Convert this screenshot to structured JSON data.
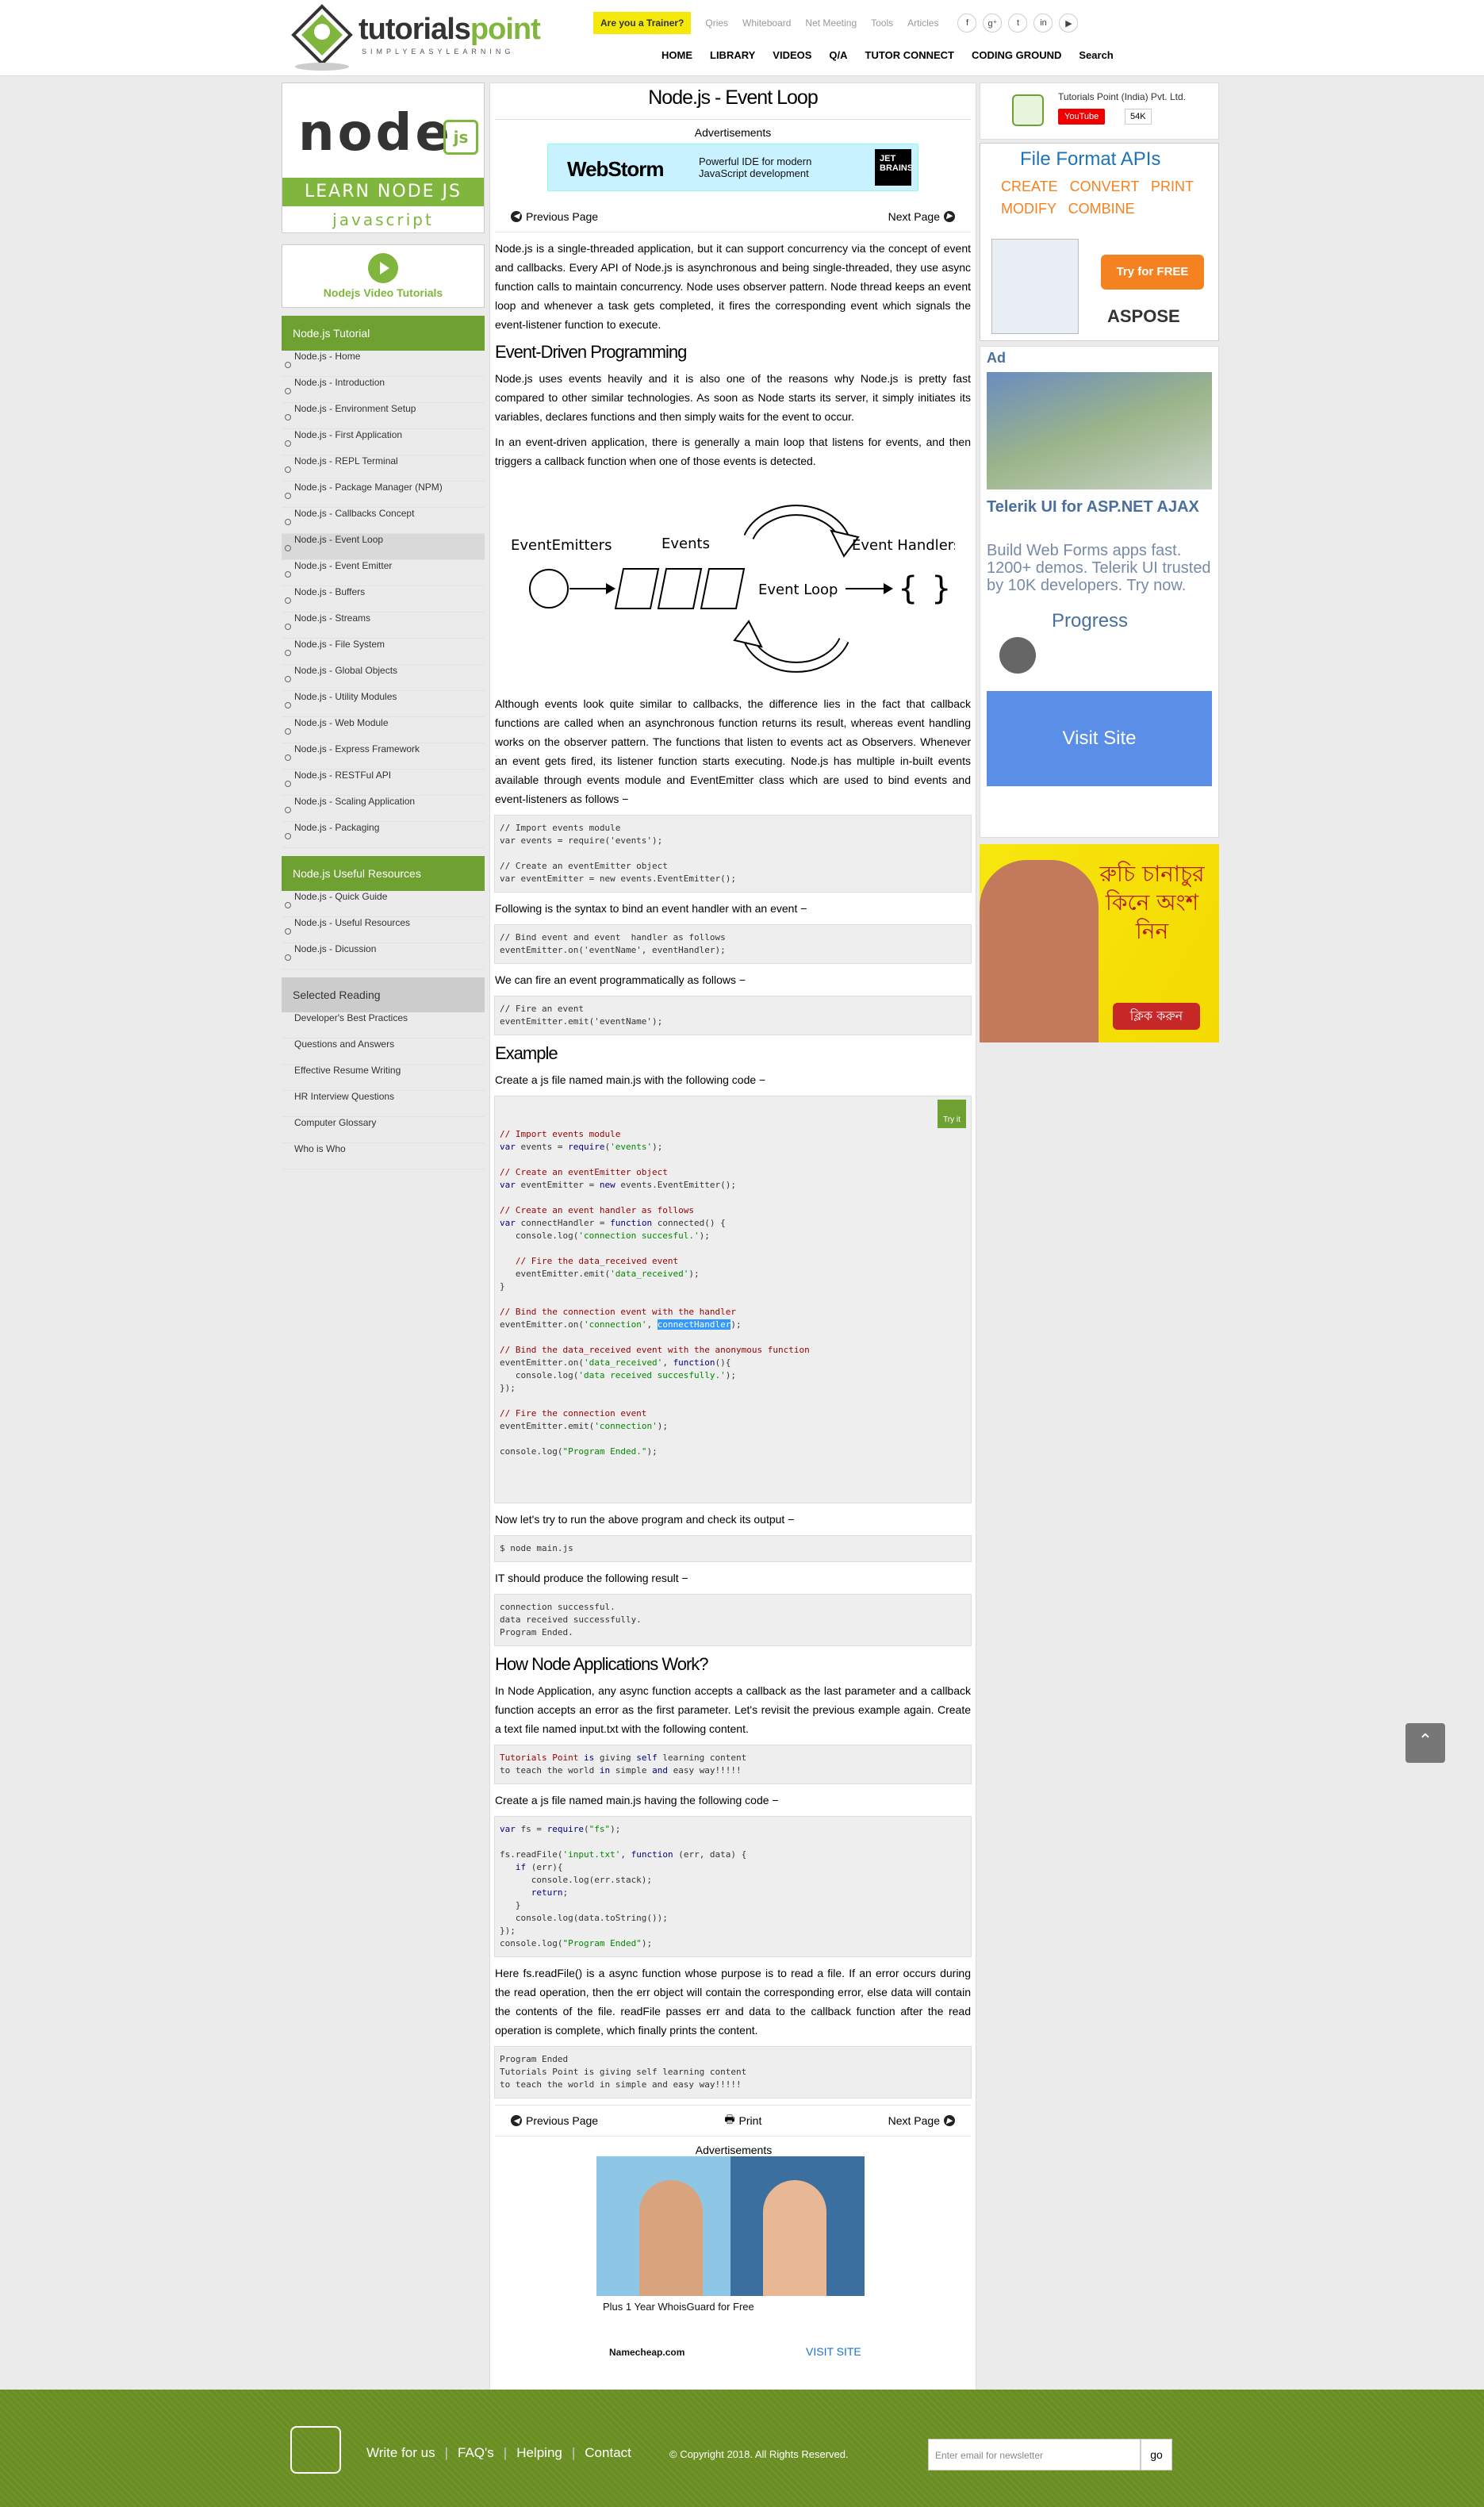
{
  "header": {
    "logo_text_a": "tutorials",
    "logo_text_b": "point",
    "logo_tagline": "SIMPLYEASYLEARNING",
    "trainer_button": "Are you a Trainer?",
    "toplinks": [
      "Qries",
      "Whiteboard",
      "Net Meeting",
      "Tools",
      "Articles"
    ],
    "social": [
      "f",
      "g⁺",
      "t",
      "in",
      "▶"
    ],
    "nav": [
      "HOME",
      "LIBRARY",
      "VIDEOS",
      "Q/A",
      "TUTOR CONNECT",
      "CODING GROUND",
      "Search"
    ]
  },
  "sidebar": {
    "node_logo": "node",
    "node_js": "js",
    "learn": "LEARN NODE JS",
    "javascript": "javascript",
    "video": "Nodejs Video Tutorials",
    "tutorial_heading": "Node.js Tutorial",
    "tutorial_items": [
      "Node.js - Home",
      "Node.js - Introduction",
      "Node.js - Environment Setup",
      "Node.js - First Application",
      "Node.js - REPL Terminal",
      "Node.js - Package Manager (NPM)",
      "Node.js - Callbacks Concept",
      "Node.js - Event Loop",
      "Node.js - Event Emitter",
      "Node.js - Buffers",
      "Node.js - Streams",
      "Node.js - File System",
      "Node.js - Global Objects",
      "Node.js - Utility Modules",
      "Node.js - Web Module",
      "Node.js - Express Framework",
      "Node.js - RESTFul API",
      "Node.js - Scaling Application",
      "Node.js - Packaging"
    ],
    "active_index": 7,
    "resources_heading": "Node.js Useful Resources",
    "resources_items": [
      "Node.js - Quick Guide",
      "Node.js - Useful Resources",
      "Node.js - Dicussion"
    ],
    "reading_heading": "Selected Reading",
    "reading_items": [
      "Developer's Best Practices",
      "Questions and Answers",
      "Effective Resume Writing",
      "HR Interview Questions",
      "Computer Glossary",
      "Who is Who"
    ]
  },
  "main": {
    "title": "Node.js - Event Loop",
    "ads_label": "Advertisements",
    "banner_brand": "WebStorm",
    "banner_text": "Powerful IDE for modern JavaScript development",
    "banner_badge": "JET BRAINS",
    "prev": "Previous Page",
    "next": "Next Page",
    "print": "Print",
    "p1": "Node.js is a single-threaded application, but it can support concurrency via the concept of event and callbacks. Every API of Node.js is asynchronous and being single-threaded, they use async function calls to maintain concurrency. Node uses observer pattern. Node thread keeps an event loop and whenever a task gets completed, it fires the corresponding event which signals the event-listener function to execute.",
    "h_event": "Event-Driven Programming",
    "p2": "Node.js uses events heavily and it is also one of the reasons why Node.js is pretty fast compared to other similar technologies. As soon as Node starts its server, it simply initiates its variables, declares functions and then simply waits for the event to occur.",
    "p3": "In an event-driven application, there is generally a main loop that listens for events, and then triggers a callback function when one of those events is detected.",
    "diagram": {
      "emitters": "EventEmitters",
      "events": "Events",
      "loop": "Event Loop",
      "handlers": "Event Handlers"
    },
    "p4": "Although events look quite similar to callbacks, the difference lies in the fact that callback functions are called when an asynchronous function returns its result, whereas event handling works on the observer pattern. The functions that listen to events act as Observers. Whenever an event gets fired, its listener function starts executing. Node.js has multiple in-built events available through events module and EventEmitter class which are used to bind events and event-listeners as follows −",
    "code1": "// Import events module\nvar events = require('events');\n\n// Create an eventEmitter object\nvar eventEmitter = new events.EventEmitter();",
    "p5": "Following is the syntax to bind an event handler with an event −",
    "code2": "// Bind event and event  handler as follows\neventEmitter.on('eventName', eventHandler);",
    "p6": "We can fire an event programmatically as follows −",
    "code3": "// Fire an event \neventEmitter.emit('eventName');",
    "h_example": "Example",
    "p7": "Create a js file named main.js with the following code −",
    "tryit": "Try it",
    "code4_html": "<span class=\"c\">// Import events module</span>\n<span class=\"k\">var</span> events = <span class=\"k\">require</span>(<span class=\"s\">'events'</span>);\n\n<span class=\"c\">// Create an eventEmitter object</span>\n<span class=\"k\">var</span> eventEmitter = <span class=\"k\">new</span> events.EventEmitter();\n\n<span class=\"c\">// Create an event handler as follows</span>\n<span class=\"k\">var</span> connectHandler = <span class=\"k\">function</span> connected() {\n   console.log(<span class=\"s\">'connection succesful.'</span>);\n  \n   <span class=\"c\">// Fire the data_received event </span>\n   eventEmitter.emit(<span class=\"s\">'data_received'</span>);\n}\n\n<span class=\"c\">// Bind the connection event with the handler</span>\neventEmitter.on(<span class=\"s\">'connection'</span>, <span class=\"hl\">connectHandler</span>);\n \n<span class=\"c\">// Bind the data_received event with the anonymous function</span>\neventEmitter.on(<span class=\"s\">'data_received'</span>, <span class=\"k\">function</span>(){\n   console.log(<span class=\"s\">'data received succesfully.'</span>);\n});\n\n<span class=\"c\">// Fire the connection event </span>\neventEmitter.emit(<span class=\"s\">'connection'</span>);\n\nconsole.log(<span class=\"s\">\"Program Ended.\"</span>);",
    "p8": "Now let's try to run the above program and check its output −",
    "code5": "$ node main.js",
    "p9": "IT should produce the following result −",
    "code6": "connection successful.\ndata received successfully.\nProgram Ended.",
    "h_how": "How Node Applications Work?",
    "p10": "In Node Application, any async function accepts a callback as the last parameter and a callback function accepts an error as the first parameter. Let's revisit the previous example again. Create a text file named input.txt with the following content.",
    "code7_html": "<span class=\"c\">Tutorials Point</span> <span class=\"k\">is</span> giving <span class=\"k\">self</span> learning content\nto teach the world <span class=\"k\">in</span> simple <span class=\"k\">and</span> easy way!!!!!",
    "p11": "Create a js file named main.js having the following code −",
    "code8_html": "<span class=\"k\">var</span> fs = <span class=\"k\">require</span>(<span class=\"s\">\"fs\"</span>);\n\nfs.readFile(<span class=\"s\">'input.txt'</span>, <span class=\"k\">function</span> (err, data) {\n   <span class=\"k\">if</span> (err){\n      console.log(err.stack);\n      <span class=\"k\">return</span>;\n   }\n   console.log(data.toString());\n});\nconsole.log(<span class=\"s\">\"Program Ended\"</span>);",
    "p12": "Here fs.readFile() is a async function whose purpose is to read a file. If an error occurs during the read operation, then the err object will contain the corresponding error, else data will contain the contents of the file. readFile passes err and data to the callback function after the read operation is complete, which finally prints the content.",
    "code9": "Program Ended\nTutorials Point is giving self learning content\nto teach the world in simple and easy way!!!!!",
    "ad2_caption": "Plus 1 Year WhoisGuard for Free",
    "ad2_brand": "Namecheap.com",
    "ad2_visit": "VISIT SITE"
  },
  "rightbar": {
    "company": "Tutorials Point (India) Pvt. Ltd.",
    "youtube": "YouTube",
    "subs": "54K",
    "aspose_title": "File Format APIs",
    "aspose_words": "CREATE   CONVERT   PRINT\nMODIFY   COMBINE",
    "aspose_try": "Try for FREE",
    "aspose_brand": "ASPOSE",
    "ad_label": "Ad",
    "telerik_title": "Telerik UI for ASP.NET AJAX",
    "telerik_body": "Build Web Forms apps fast. 1200+ demos. Telerik UI trusted by 10K developers. Try now.",
    "progress": "Progress",
    "visit": "Visit Site",
    "bengali_text": "রুচি চানাচুর কিনে অংশ নিন",
    "bengali_btn": "ক্লিক করুন"
  },
  "footer": {
    "links": [
      "Write for us",
      "FAQ's",
      "Helping",
      "Contact"
    ],
    "copyright": "© Copyright 2018. All Rights Reserved.",
    "newsletter_placeholder": "Enter email for newsletter",
    "go": "go"
  }
}
